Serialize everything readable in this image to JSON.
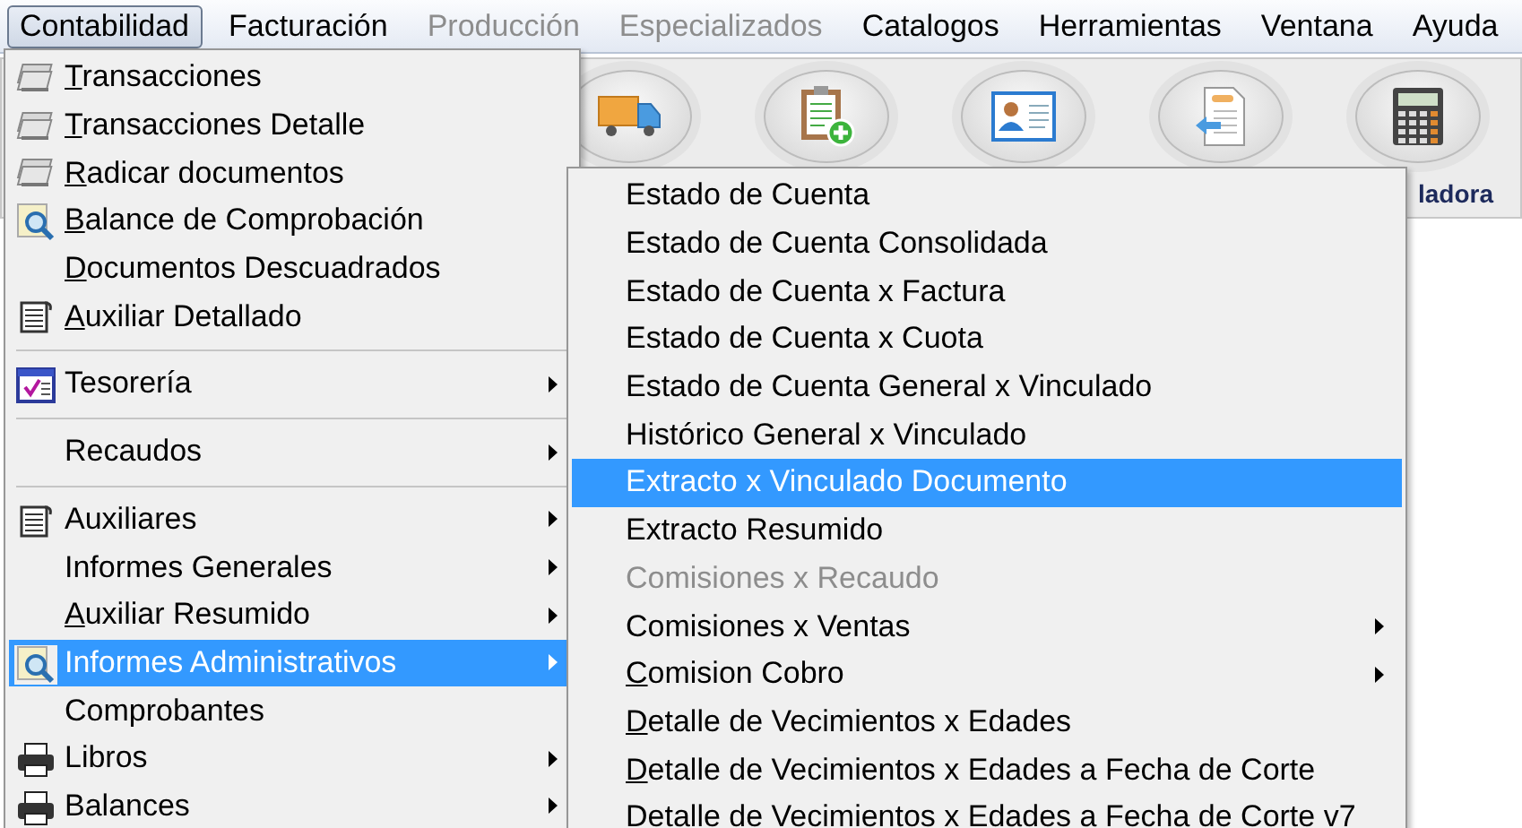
{
  "menu_bar": [
    {
      "label": "Contabilidad",
      "selected": true,
      "disabled": false
    },
    {
      "label": "Facturación",
      "selected": false,
      "disabled": false
    },
    {
      "label": "Producción",
      "selected": false,
      "disabled": true
    },
    {
      "label": "Especializados",
      "selected": false,
      "disabled": true
    },
    {
      "label": "Catalogos",
      "selected": false,
      "disabled": false
    },
    {
      "label": "Herramientas",
      "selected": false,
      "disabled": false
    },
    {
      "label": "Ventana",
      "selected": false,
      "disabled": false
    },
    {
      "label": "Ayuda",
      "selected": false,
      "disabled": false
    }
  ],
  "toolbar": {
    "buttons": [
      {
        "kind": "truck"
      },
      {
        "kind": "clipboard"
      },
      {
        "kind": "card"
      },
      {
        "kind": "document"
      },
      {
        "kind": "calculator",
        "caption": "ladora"
      }
    ]
  },
  "menu": {
    "items": [
      {
        "kind": "papers",
        "label": "Transacciones",
        "mnemonic": true,
        "selected": false,
        "has_submenu": false
      },
      {
        "kind": "papers",
        "label": "Transacciones Detalle",
        "mnemonic": true,
        "selected": false,
        "has_submenu": false
      },
      {
        "kind": "papers",
        "label": "Radicar documentos",
        "mnemonic": true,
        "selected": false,
        "has_submenu": false
      },
      {
        "kind": "magnifier",
        "label": "Balance de Comprobación",
        "mnemonic": true,
        "selected": false,
        "has_submenu": false
      },
      {
        "kind": "plain",
        "label": "Documentos Descuadrados",
        "mnemonic": true,
        "selected": false,
        "has_submenu": false
      },
      {
        "kind": "notebook",
        "label": "Auxiliar Detallado",
        "mnemonic": true,
        "selected": false,
        "has_submenu": false
      },
      {
        "kind": "separator"
      },
      {
        "kind": "calendar",
        "label": "Tesorería",
        "mnemonic": false,
        "selected": false,
        "has_submenu": true
      },
      {
        "kind": "separator"
      },
      {
        "kind": "plain",
        "label": "Recaudos",
        "mnemonic": false,
        "selected": false,
        "has_submenu": true
      },
      {
        "kind": "separator"
      },
      {
        "kind": "notebook",
        "label": "Auxiliares",
        "mnemonic": false,
        "selected": false,
        "has_submenu": true
      },
      {
        "kind": "plain",
        "label": "Informes Generales",
        "mnemonic": false,
        "selected": false,
        "has_submenu": true
      },
      {
        "kind": "plain",
        "label": "Auxiliar Resumido",
        "mnemonic": true,
        "selected": false,
        "has_submenu": true
      },
      {
        "kind": "magnifier",
        "label": "Informes Administrativos",
        "mnemonic": false,
        "selected": true,
        "has_submenu": true
      },
      {
        "kind": "plain",
        "label": "Comprobantes",
        "mnemonic": false,
        "selected": false,
        "has_submenu": false
      },
      {
        "kind": "printer",
        "label": "Libros",
        "mnemonic": false,
        "selected": false,
        "has_submenu": true
      },
      {
        "kind": "printer",
        "label": "Balances",
        "mnemonic": false,
        "selected": false,
        "has_submenu": true
      }
    ]
  },
  "submenu": {
    "items": [
      {
        "label": "Estado de Cuenta",
        "mnemonic": false,
        "selected": false,
        "disabled": false,
        "has_submenu": false
      },
      {
        "label": "Estado de Cuenta Consolidada",
        "mnemonic": false,
        "selected": false,
        "disabled": false,
        "has_submenu": false
      },
      {
        "label": "Estado de Cuenta x Factura",
        "mnemonic": false,
        "selected": false,
        "disabled": false,
        "has_submenu": false
      },
      {
        "label": "Estado de Cuenta x Cuota",
        "mnemonic": false,
        "selected": false,
        "disabled": false,
        "has_submenu": false
      },
      {
        "label": "Estado de Cuenta General x Vinculado",
        "mnemonic": false,
        "selected": false,
        "disabled": false,
        "has_submenu": false
      },
      {
        "label": "Histórico General x Vinculado",
        "mnemonic": false,
        "selected": false,
        "disabled": false,
        "has_submenu": false
      },
      {
        "label": "Extracto x Vinculado Documento",
        "mnemonic": false,
        "selected": true,
        "disabled": false,
        "has_submenu": false
      },
      {
        "label": "Extracto Resumido",
        "mnemonic": false,
        "selected": false,
        "disabled": false,
        "has_submenu": false
      },
      {
        "label": "Comisiones x Recaudo",
        "mnemonic": false,
        "selected": false,
        "disabled": true,
        "has_submenu": false
      },
      {
        "label": "Comisiones x Ventas",
        "mnemonic": false,
        "selected": false,
        "disabled": false,
        "has_submenu": true
      },
      {
        "label": "Comision Cobro",
        "mnemonic": true,
        "selected": false,
        "disabled": false,
        "has_submenu": true
      },
      {
        "label": "Detalle de Vecimientos x Edades",
        "mnemonic": true,
        "selected": false,
        "disabled": false,
        "has_submenu": false
      },
      {
        "label": "Detalle de Vecimientos x Edades a Fecha de Corte",
        "mnemonic": true,
        "selected": false,
        "disabled": false,
        "has_submenu": false
      },
      {
        "label": "Detalle de Vecimientos x Edades a Fecha de Corte v7",
        "mnemonic": true,
        "selected": false,
        "disabled": false,
        "has_submenu": false
      }
    ]
  }
}
